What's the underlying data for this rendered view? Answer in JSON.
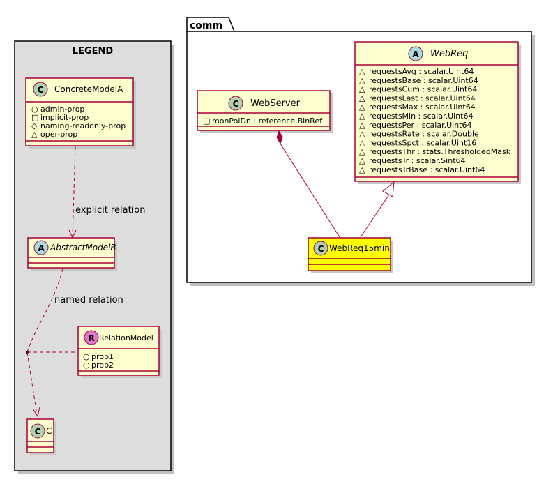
{
  "legend": {
    "title": "LEGEND",
    "concrete": {
      "stereo": "C",
      "name": "ConcreteModelA",
      "props": [
        {
          "vis": "○",
          "text": "admin-prop"
        },
        {
          "vis": "□",
          "text": "implicit-prop"
        },
        {
          "vis": "◇",
          "text": "naming-readonly-prop"
        },
        {
          "vis": "△",
          "text": "oper-prop"
        }
      ]
    },
    "abstract": {
      "stereo": "A",
      "name": "AbstractModelB"
    },
    "relation": {
      "stereo": "R",
      "name": "RelationModel",
      "props": [
        {
          "vis": "○",
          "text": "prop1"
        },
        {
          "vis": "○",
          "text": "prop2"
        }
      ]
    },
    "c": {
      "stereo": "C",
      "name": "C"
    },
    "explicit_label": "explicit relation",
    "named_label": "named relation"
  },
  "package": {
    "name": "comm",
    "webserver": {
      "stereo": "C",
      "name": "WebServer",
      "props": [
        {
          "vis": "□",
          "text": "monPolDn : reference.BinRef"
        }
      ]
    },
    "webreq": {
      "stereo": "A",
      "name": "WebReq",
      "props": [
        {
          "vis": "△",
          "text": "requestsAvg : scalar.Uint64"
        },
        {
          "vis": "△",
          "text": "requestsBase : scalar.Uint64"
        },
        {
          "vis": "△",
          "text": "requestsCum : scalar.Uint64"
        },
        {
          "vis": "△",
          "text": "requestsLast : scalar.Uint64"
        },
        {
          "vis": "△",
          "text": "requestsMax : scalar.Uint64"
        },
        {
          "vis": "△",
          "text": "requestsMin : scalar.Uint64"
        },
        {
          "vis": "△",
          "text": "requestsPer : scalar.Uint64"
        },
        {
          "vis": "△",
          "text": "requestsRate : scalar.Double"
        },
        {
          "vis": "△",
          "text": "requestsSpct : scalar.Uint16"
        },
        {
          "vis": "△",
          "text": "requestsThr : stats.ThresholdedMask"
        },
        {
          "vis": "△",
          "text": "requestsTr : scalar.Sint64"
        },
        {
          "vis": "△",
          "text": "requestsTrBase : scalar.Uint64"
        }
      ]
    },
    "webreq15": {
      "stereo": "C",
      "name": "WebReq15min"
    }
  },
  "colors": {
    "class_fill": "#FEFECE",
    "border": "#A80036",
    "highlight_fill": "#FFFF00",
    "legend_bg": "#DDDDDD",
    "circle_c": "#ADD1B2",
    "circle_a": "#A9DCDF",
    "circle_r": "#E078C8"
  }
}
